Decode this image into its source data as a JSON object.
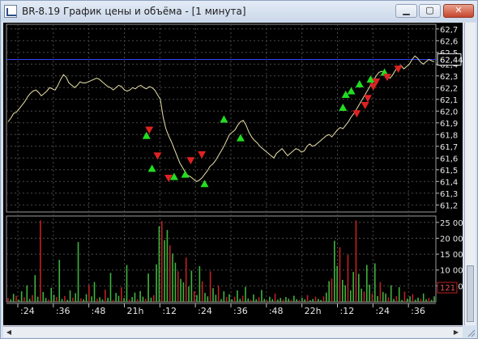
{
  "window": {
    "title": "BR-8.19 График цены и объёма - [1 минута]",
    "buttons": {
      "minimize": "▁",
      "maximize": "▢",
      "close": "✕"
    }
  },
  "colors": {
    "background": "#000000",
    "price_line": "#e8e0a8",
    "grid": "#4a4a4a",
    "level_line": "#3344ff",
    "buy": "#22dd22",
    "sell": "#dd2222",
    "volume_up": "#3fb33f",
    "volume_down": "#c02020"
  },
  "price_axis": {
    "ticks": [
      "62,7",
      "62,6",
      "62,5",
      "62,4",
      "62,3",
      "62,2",
      "62,1",
      "62,0",
      "61,9",
      "61,8",
      "61,7",
      "61,6",
      "61,5",
      "61,4",
      "61,3",
      "61,2"
    ],
    "current": "62,44",
    "level": 62.44
  },
  "volume_axis": {
    "ticks": [
      "25 000",
      "20 000",
      "15 000",
      "10 000",
      "5 000"
    ],
    "current": "121"
  },
  "time_axis": {
    "labels": [
      ":24",
      ":36",
      ":48",
      "21h",
      ":12",
      ":24",
      ":36",
      ":48",
      "22h",
      ":12",
      ":24",
      ":36"
    ]
  },
  "chart_data": [
    {
      "type": "line",
      "name": "price",
      "ylim": [
        61.14,
        62.74
      ],
      "points": [
        61.91,
        61.94,
        61.98,
        61.99,
        62.02,
        62.05,
        62.08,
        62.12,
        62.15,
        62.17,
        62.18,
        62.16,
        62.13,
        62.15,
        62.17,
        62.2,
        62.19,
        62.18,
        62.22,
        62.27,
        62.31,
        62.29,
        62.24,
        62.22,
        62.2,
        62.22,
        62.25,
        62.24,
        62.24,
        62.25,
        62.26,
        62.27,
        62.28,
        62.27,
        62.25,
        62.23,
        62.21,
        62.2,
        62.18,
        62.2,
        62.22,
        62.21,
        62.18,
        62.17,
        62.18,
        62.2,
        62.19,
        62.21,
        62.22,
        62.2,
        62.19,
        62.21,
        62.2,
        62.18,
        62.14,
        62.1,
        61.95,
        61.85,
        61.79,
        61.74,
        61.68,
        61.62,
        61.56,
        61.52,
        61.48,
        61.45,
        61.44,
        61.42,
        61.4,
        61.41,
        61.43,
        61.46,
        61.49,
        61.53,
        61.55,
        61.58,
        61.62,
        61.66,
        61.7,
        61.75,
        61.8,
        61.82,
        61.84,
        61.88,
        61.91,
        61.92,
        61.88,
        61.82,
        61.78,
        61.75,
        61.73,
        61.7,
        61.68,
        61.66,
        61.64,
        61.62,
        61.6,
        61.64,
        61.66,
        61.68,
        61.65,
        61.62,
        61.64,
        61.66,
        61.68,
        61.67,
        61.65,
        61.66,
        61.7,
        61.72,
        61.7,
        61.71,
        61.73,
        61.75,
        61.77,
        61.79,
        61.8,
        61.78,
        61.81,
        61.84,
        61.86,
        61.85,
        61.88,
        61.91,
        61.95,
        61.98,
        62.02,
        62.06,
        62.1,
        62.14,
        62.18,
        62.22,
        62.26,
        62.3,
        62.33,
        62.34,
        62.33,
        62.3,
        62.28,
        62.31,
        62.35,
        62.38,
        62.39,
        62.36,
        62.38,
        62.4,
        62.44,
        62.47,
        62.45,
        62.42,
        62.4,
        62.42,
        62.44,
        62.43,
        62.42
      ]
    },
    {
      "type": "bar",
      "name": "volume",
      "ylim": [
        0,
        27000
      ],
      "values": [
        1200,
        800,
        2500,
        1900,
        600,
        3300,
        1400,
        5200,
        900,
        2100,
        8400,
        1600,
        25600,
        3100,
        1200,
        700,
        4400,
        2200,
        1500,
        13200,
        900,
        1800,
        600,
        3600,
        1300,
        2700,
        18800,
        1100,
        800,
        2400,
        5300,
        1700,
        6200,
        950,
        1400,
        750,
        3800,
        1250,
        9100,
        600,
        2800,
        1900,
        4600,
        1200,
        11600,
        700,
        1500,
        2900,
        820,
        3400,
        1600,
        940,
        8900,
        1300,
        2100,
        11800,
        23800,
        25400,
        19400,
        22600,
        17800,
        15200,
        12300,
        9600,
        7200,
        6100,
        13900,
        4800,
        9800,
        3300,
        2100,
        11200,
        6400,
        2800,
        1700,
        9600,
        4300,
        2200,
        5100,
        850,
        3300,
        1500,
        2400,
        780,
        1600,
        3600,
        920,
        1900,
        4700,
        1050,
        600,
        2300,
        780,
        1450,
        3700,
        920,
        500,
        1600,
        840,
        2600,
        680,
        1200,
        720,
        1500,
        950,
        600,
        1900,
        820,
        540,
        1300,
        760,
        2100,
        490,
        880,
        1600,
        920,
        560,
        1700,
        2900,
        6500,
        7300,
        19200,
        11300,
        17200,
        6900,
        5200,
        14800,
        3600,
        9400,
        25600,
        8800,
        4100,
        3200,
        11600,
        5400,
        2600,
        12100,
        1800,
        6200,
        3100,
        2600,
        1400,
        5200,
        900,
        1800,
        4600,
        600,
        3200,
        1000,
        1700,
        2400,
        650,
        1300,
        900,
        2600,
        800,
        1200,
        620,
        1700
      ]
    }
  ],
  "signals": {
    "buy": [
      [
        50,
        61.79
      ],
      [
        52,
        61.51
      ],
      [
        60,
        61.44
      ],
      [
        64,
        61.46
      ],
      [
        71,
        61.38
      ],
      [
        78,
        61.93
      ],
      [
        84,
        61.77
      ],
      [
        121,
        62.03
      ],
      [
        122,
        62.14
      ],
      [
        124,
        62.17
      ],
      [
        127,
        62.23
      ],
      [
        131,
        62.27
      ],
      [
        136,
        62.33
      ]
    ],
    "sell": [
      [
        51,
        61.84
      ],
      [
        54,
        61.62
      ],
      [
        58,
        61.43
      ],
      [
        66,
        61.58
      ],
      [
        70,
        61.63
      ],
      [
        126,
        61.98
      ],
      [
        129,
        62.05
      ],
      [
        130,
        62.11
      ],
      [
        132,
        62.21
      ],
      [
        133,
        62.25
      ],
      [
        137,
        62.29
      ],
      [
        141,
        62.36
      ]
    ]
  }
}
